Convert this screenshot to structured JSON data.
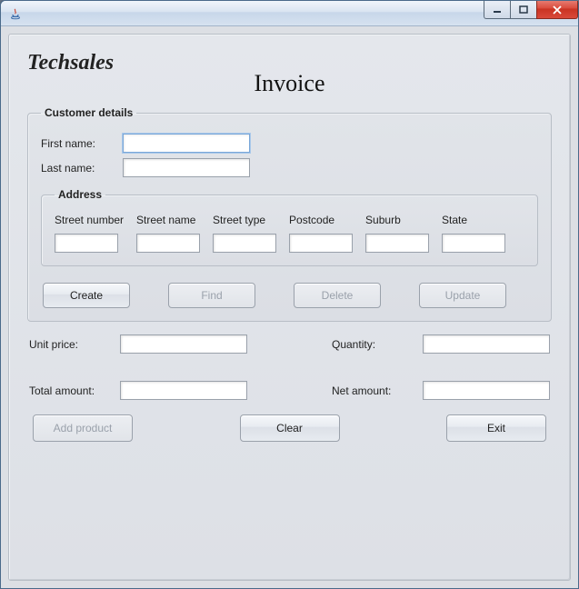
{
  "window": {
    "title": ""
  },
  "brand": "Techsales",
  "page_title": "Invoice",
  "customer": {
    "legend": "Customer details",
    "first_name_label": "First name:",
    "first_name_value": "",
    "last_name_label": "Last name:",
    "last_name_value": ""
  },
  "address": {
    "legend": "Address",
    "cols": {
      "street_number": {
        "label": "Street number",
        "value": ""
      },
      "street_name": {
        "label": "Street name",
        "value": ""
      },
      "street_type": {
        "label": "Street type",
        "value": ""
      },
      "postcode": {
        "label": "Postcode",
        "value": ""
      },
      "suburb": {
        "label": "Suburb",
        "value": ""
      },
      "state": {
        "label": "State",
        "value": ""
      }
    }
  },
  "buttons": {
    "create": "Create",
    "find": "Find",
    "delete": "Delete",
    "update": "Update",
    "add_product": "Add product",
    "clear": "Clear",
    "exit": "Exit"
  },
  "amounts": {
    "unit_price_label": "Unit price:",
    "unit_price_value": "",
    "quantity_label": "Quantity:",
    "quantity_value": "",
    "total_label": "Total amount:",
    "total_value": "",
    "net_label": "Net amount:",
    "net_value": ""
  }
}
